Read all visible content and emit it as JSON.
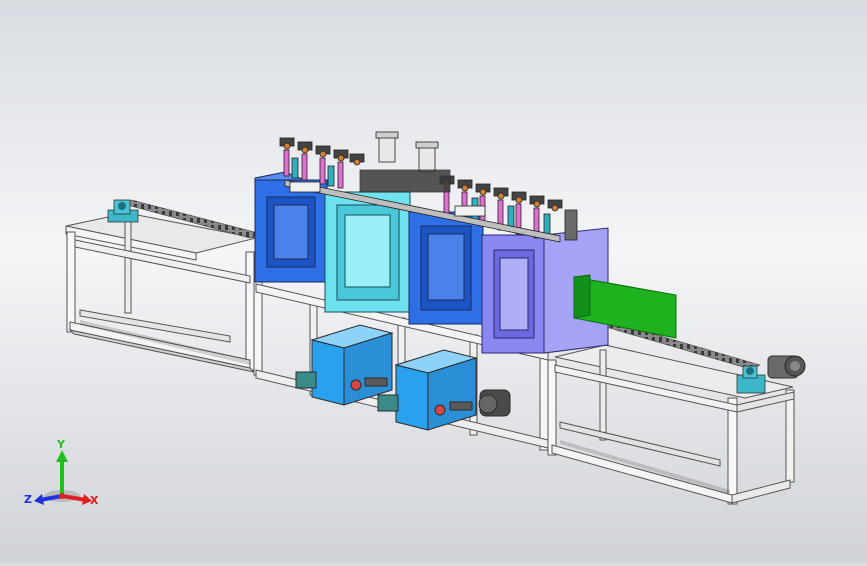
{
  "triad": {
    "x_label": "X",
    "y_label": "Y",
    "z_label": "Z",
    "colors": {
      "x": "#e02020",
      "y": "#1fbf1f",
      "z": "#2030e0"
    }
  },
  "palette": {
    "frame": "#f2f2f2",
    "frame_edge": "#555555",
    "box_blue": "#2f6fe6",
    "box_cyan": "#6fe2ef",
    "box_violet": "#8a86f2",
    "tank_blue": "#2aa3ee",
    "green_plate": "#1fb21f"
  }
}
